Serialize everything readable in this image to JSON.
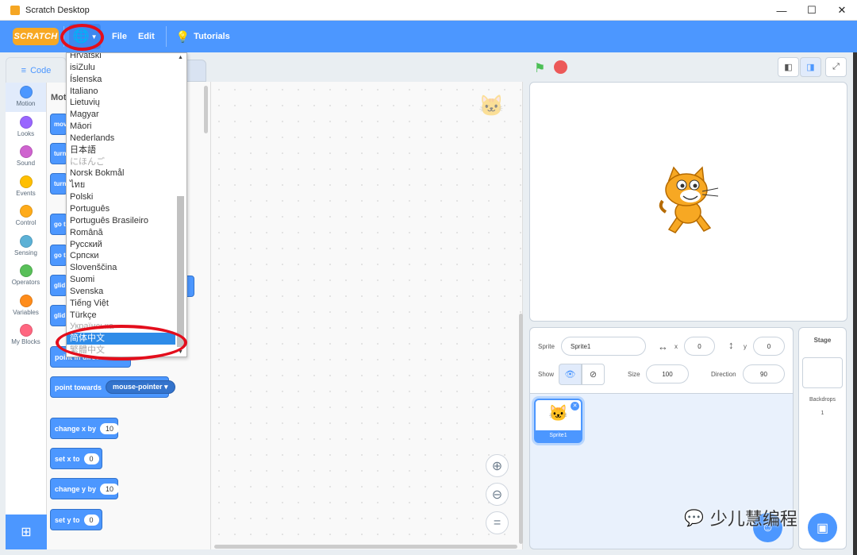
{
  "window": {
    "title": "Scratch Desktop",
    "min": "—",
    "max": "☐",
    "close": "✕"
  },
  "menubar": {
    "logo": "SCRATCH",
    "file": "File",
    "edit": "Edit",
    "tutorials": "Tutorials"
  },
  "tabs": {
    "code": "Code",
    "other": "ds"
  },
  "categories": [
    "Motion",
    "Looks",
    "Sound",
    "Events",
    "Control",
    "Sensing",
    "Operators",
    "Variables",
    "My Blocks"
  ],
  "category_colors": [
    "#4c97ff",
    "#9966ff",
    "#cf63cf",
    "#ffbf00",
    "#ffab19",
    "#5cb1d6",
    "#59c059",
    "#ff8c1a",
    "#ff6680"
  ],
  "palette": {
    "heading": "Mot",
    "stubs": [
      "mov",
      "turn",
      "turn",
      "go t",
      "go t",
      "glid",
      "glid"
    ],
    "point_direction": "point in direction",
    "point_towards": "point towards",
    "point_towards_value": "mouse-pointer",
    "change_x": "change x by",
    "change_x_val": "10",
    "set_x": "set x to",
    "set_x_val": "0",
    "change_y": "change y by",
    "change_y_val": "10",
    "set_y": "set y to",
    "set_y_val": "0"
  },
  "languages": [
    "Hrvatski",
    "isiZulu",
    "Íslenska",
    "Italiano",
    "Lietuvių",
    "Magyar",
    "Māori",
    "Nederlands",
    "日本語",
    "にほんご",
    "Norsk Bokmål",
    "ไทย",
    "Polski",
    "Português",
    "Português Brasileiro",
    "Română",
    "Русский",
    "Српски",
    "Slovenščina",
    "Suomi",
    "Svenska",
    "Tiếng Việt",
    "Türkçe",
    "Українська",
    "简体中文",
    "繁體中文"
  ],
  "selected_language": "简体中文",
  "sprite": {
    "sprite_label": "Sprite",
    "name": "Sprite1",
    "x_label": "x",
    "x": "0",
    "y_label": "y",
    "y": "0",
    "show_label": "Show",
    "size_label": "Size",
    "size": "100",
    "direction_label": "Direction",
    "direction": "90",
    "thumb_name": "Sprite1"
  },
  "stage_panel": {
    "title": "Stage",
    "backdrops_label": "Backdrops",
    "backdrops_count": "1"
  },
  "watermark": "少儿慧编程",
  "icons": {
    "globe": "globe-icon",
    "flag": "green-flag-icon",
    "stop": "stop-icon",
    "zoom_in": "zoom-in-icon",
    "zoom_out": "zoom-out-icon",
    "zoom_reset": "zoom-reset-icon"
  }
}
